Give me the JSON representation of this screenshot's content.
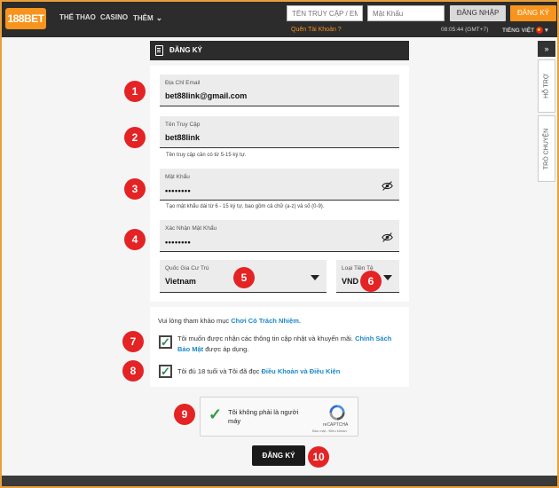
{
  "header": {
    "logo_text": "188BET",
    "nav": {
      "sports": "THỂ THAO",
      "casino": "CASINO",
      "more": "THÊM"
    },
    "username_placeholder": "TÊN TRUY CẬP / EM",
    "password_placeholder": "Mật Khẩu",
    "login_label": "ĐĂNG NHẬP",
    "register_label": "ĐĂNG KÝ",
    "forgot_label": "Quên Tài Khoản ?",
    "clock": "08:05:44 (GMT+7)",
    "language": "TIẾNG VIỆT"
  },
  "side_panel": {
    "expand": "»",
    "support": "HỖ TRỢ",
    "chat": "TRÒ CHUYỆN"
  },
  "section": {
    "title": "ĐĂNG KÝ"
  },
  "form": {
    "email": {
      "label": "Địa Chỉ Email",
      "value": "bet88link@gmail.com"
    },
    "username": {
      "label": "Tên Truy Cập",
      "value": "bet88link",
      "hint": "Tên truy cập cần có từ 5-15 ký tự."
    },
    "password": {
      "label": "Mật Khẩu",
      "value": "••••••••",
      "hint": "Tạo mật khẩu dài từ 6 - 15 ký tự, bao gồm cả chữ (a-z) và số (0-9)."
    },
    "confirm": {
      "label": "Xác Nhận Mật Khẩu",
      "value": "••••••••"
    },
    "country": {
      "label": "Quốc Gia Cư Trú",
      "value": "Vietnam"
    },
    "currency": {
      "label": "Loại Tiền Tệ",
      "value": "VND"
    }
  },
  "agreements": {
    "responsible_prefix": "Vui lòng tham khảo mục ",
    "responsible_link": "Chơi Có Trách Nhiệm.",
    "news_prefix": "Tôi muốn được nhận các thông tin cập nhật và khuyến mãi. ",
    "news_link": "Chính Sách Bảo Mật",
    "news_suffix": " được áp dụng.",
    "age_prefix": "Tôi đủ 18 tuổi và Tôi đã đọc ",
    "age_link": "Điều Khoản và Điều Kiện",
    "news_checked": true,
    "age_checked": true
  },
  "captcha": {
    "text": "Tôi không phải là người máy",
    "brand": "reCAPTCHA",
    "terms": "Bảo mật - Điều khoản"
  },
  "submit_label": "ĐĂNG KÝ",
  "callouts": [
    "1",
    "2",
    "3",
    "4",
    "5",
    "6",
    "7",
    "8",
    "9",
    "10"
  ],
  "colors": {
    "accent": "#f7941d",
    "callout": "#e42325",
    "link": "#1e88c7",
    "dark": "#2c2c2c"
  }
}
